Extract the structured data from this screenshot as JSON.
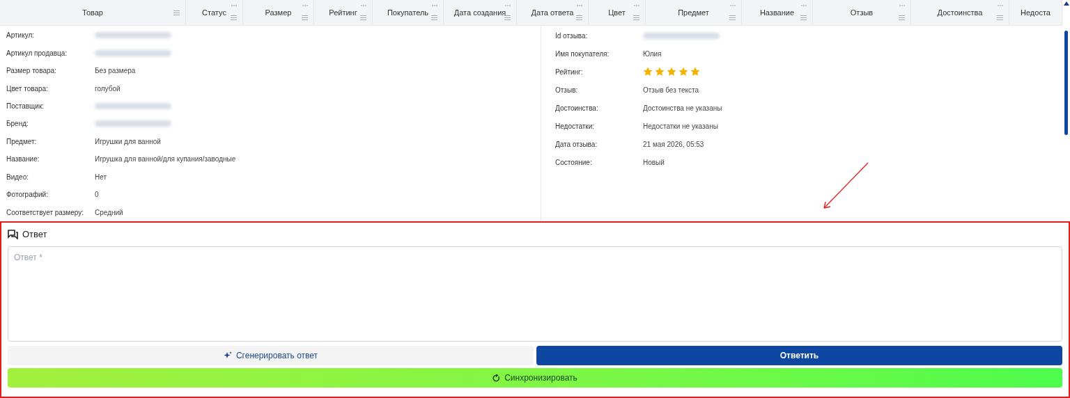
{
  "table": {
    "columns": [
      {
        "label": "Товар"
      },
      {
        "label": "Статус"
      },
      {
        "label": "Размер"
      },
      {
        "label": "Рейтинг"
      },
      {
        "label": "Покупатель"
      },
      {
        "label": "Дата создания"
      },
      {
        "label": "Дата ответа"
      },
      {
        "label": "Цвет"
      },
      {
        "label": "Предмет"
      },
      {
        "label": "Название"
      },
      {
        "label": "Отзыв"
      },
      {
        "label": "Достоинства"
      },
      {
        "label": "Недоста"
      }
    ]
  },
  "product_details": [
    {
      "label": "Артикул:",
      "kind": "blurred"
    },
    {
      "label": "Артикул продавца:",
      "kind": "blurred"
    },
    {
      "label": "Размер товара:",
      "kind": "text",
      "value": "Без размера"
    },
    {
      "label": "Цвет товара:",
      "kind": "text",
      "value": "голубой"
    },
    {
      "label": "Поставщик:",
      "kind": "blurred"
    },
    {
      "label": "Бренд:",
      "kind": "blurred"
    },
    {
      "label": "Предмет:",
      "kind": "text",
      "value": "Игрушки для ванной"
    },
    {
      "label": "Название:",
      "kind": "text",
      "value": "Игрушка для ванной/для купания/заводные"
    },
    {
      "label": "Видео:",
      "kind": "text",
      "value": "Нет"
    },
    {
      "label": "Фотографий:",
      "kind": "text",
      "value": "0"
    },
    {
      "label": "Соответствует размеру:",
      "kind": "text",
      "value": "Средний"
    }
  ],
  "review_details": [
    {
      "label": "Id отзыва:",
      "kind": "blurred"
    },
    {
      "label": "Имя покупателя:",
      "kind": "text",
      "value": "Юлия"
    },
    {
      "label": "Рейтинг:",
      "kind": "stars",
      "stars": 5
    },
    {
      "label": "Отзыв:",
      "kind": "text",
      "value": "Отзыв без текста"
    },
    {
      "label": "Достоинства:",
      "kind": "text",
      "value": "Достоинства не указаны"
    },
    {
      "label": "Недостатки:",
      "kind": "text",
      "value": "Недостатки не указаны"
    },
    {
      "label": "Дата отзыва:",
      "kind": "text",
      "value": "21 мая 2026, 05:53"
    },
    {
      "label": "Состояние:",
      "kind": "text",
      "value": "Новый"
    }
  ],
  "answer": {
    "title": "Ответ",
    "placeholder": "Ответ *",
    "generate_button": "Сгенерировать ответ",
    "reply_button": "Ответить",
    "sync_button": "Синхронизировать"
  }
}
